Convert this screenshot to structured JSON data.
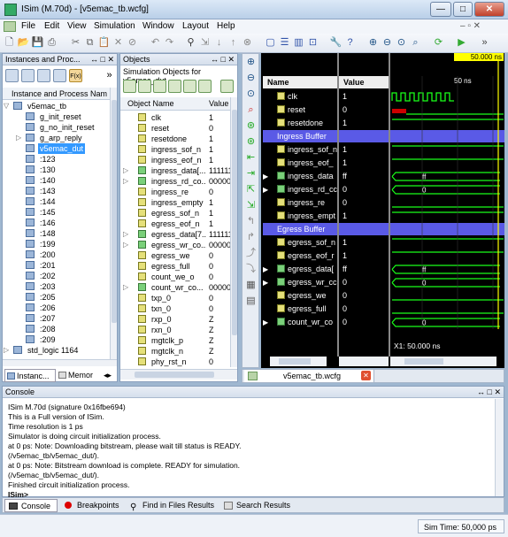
{
  "window": {
    "title": "ISim (M.70d) - [v5emac_tb.wcfg]",
    "buttons": [
      "—",
      "□",
      "✕"
    ]
  },
  "menu": [
    "File",
    "Edit",
    "View",
    "Simulation",
    "Window",
    "Layout",
    "Help"
  ],
  "instances_panel": {
    "title": "Instances and Proc...",
    "column": "Instance and Process Nam",
    "tree": [
      {
        "label": "v5emac_tb",
        "level": 0,
        "expand": "▽"
      },
      {
        "label": "g_init_reset",
        "level": 1,
        "expand": ""
      },
      {
        "label": "g_no_init_reset",
        "level": 1,
        "expand": ""
      },
      {
        "label": "g_arp_reply",
        "level": 1,
        "expand": "▷"
      },
      {
        "label": "v5emac_dut",
        "level": 1,
        "expand": "",
        "selected": true
      },
      {
        "label": ":123",
        "level": 1
      },
      {
        "label": ":130",
        "level": 1
      },
      {
        "label": ":140",
        "level": 1
      },
      {
        "label": ":143",
        "level": 1
      },
      {
        "label": ":144",
        "level": 1
      },
      {
        "label": ":145",
        "level": 1
      },
      {
        "label": ":146",
        "level": 1
      },
      {
        "label": ":148",
        "level": 1
      },
      {
        "label": ":199",
        "level": 1
      },
      {
        "label": ":200",
        "level": 1
      },
      {
        "label": ":201",
        "level": 1
      },
      {
        "label": ":202",
        "level": 1
      },
      {
        "label": ":203",
        "level": 1
      },
      {
        "label": ":205",
        "level": 1
      },
      {
        "label": ":206",
        "level": 1
      },
      {
        "label": ":207",
        "level": 1
      },
      {
        "label": ":208",
        "level": 1
      },
      {
        "label": ":209",
        "level": 1
      },
      {
        "label": "std_logic 1164",
        "level": 0,
        "expand": "▷"
      }
    ],
    "tabs": [
      "Instanc...",
      "Memor"
    ]
  },
  "objects_panel": {
    "title": "Objects",
    "subtitle": "Simulation Objects for v5emac_dut",
    "col_name": "Object Name",
    "col_value": "Value",
    "rows": [
      {
        "name": "clk",
        "value": "1",
        "bus": false
      },
      {
        "name": "reset",
        "value": "0",
        "bus": false
      },
      {
        "name": "resetdone",
        "value": "1",
        "bus": false
      },
      {
        "name": "ingress_sof_n",
        "value": "1",
        "bus": false
      },
      {
        "name": "ingress_eof_n",
        "value": "1",
        "bus": false
      },
      {
        "name": "ingress_data[...",
        "value": "1111111",
        "bus": true
      },
      {
        "name": "ingress_rd_co...",
        "value": "0000000",
        "bus": true
      },
      {
        "name": "ingress_re",
        "value": "0",
        "bus": false
      },
      {
        "name": "ingress_empty",
        "value": "1",
        "bus": false
      },
      {
        "name": "egress_sof_n",
        "value": "1",
        "bus": false
      },
      {
        "name": "egress_eof_n",
        "value": "1",
        "bus": false
      },
      {
        "name": "egress_data[7...",
        "value": "1111111",
        "bus": true
      },
      {
        "name": "egress_wr_co...",
        "value": "0000000",
        "bus": true
      },
      {
        "name": "egress_we",
        "value": "0",
        "bus": false
      },
      {
        "name": "egress_full",
        "value": "0",
        "bus": false
      },
      {
        "name": "count_we_o",
        "value": "0",
        "bus": false
      },
      {
        "name": "count_wr_co...",
        "value": "00000",
        "bus": true
      },
      {
        "name": "txp_0",
        "value": "0",
        "bus": false
      },
      {
        "name": "txn_0",
        "value": "0",
        "bus": false
      },
      {
        "name": "rxp_0",
        "value": "Z",
        "bus": false
      },
      {
        "name": "rxn_0",
        "value": "Z",
        "bus": false
      },
      {
        "name": "mgtclk_p",
        "value": "Z",
        "bus": false
      },
      {
        "name": "mgtclk_n",
        "value": "Z",
        "bus": false
      },
      {
        "name": "phy_rst_n",
        "value": "0",
        "bus": false
      }
    ]
  },
  "wave": {
    "col_name": "Name",
    "col_value": "Value",
    "cursor_label": "50.000 ns",
    "tick_label": "50 ns",
    "rows": [
      {
        "name": "clk",
        "value": "1",
        "kind": "clock"
      },
      {
        "name": "reset",
        "value": "0",
        "kind": "reset"
      },
      {
        "name": "resetdone",
        "value": "1",
        "kind": "high"
      },
      {
        "name": "Ingress Buffer",
        "value": "",
        "kind": "group"
      },
      {
        "name": "ingress_sof_n",
        "value": "1",
        "kind": "high"
      },
      {
        "name": "ingress_eof_n",
        "value": "1",
        "kind": "high"
      },
      {
        "name": "ingress_data[7:0]",
        "value": "ff",
        "kind": "bus",
        "busval": "ff"
      },
      {
        "name": "ingress_rd_count",
        "value": "0",
        "kind": "bus",
        "busval": "0"
      },
      {
        "name": "ingress_re",
        "value": "0",
        "kind": "low"
      },
      {
        "name": "ingress_empty",
        "value": "1",
        "kind": "high"
      },
      {
        "name": "Egress Buffer",
        "value": "",
        "kind": "group"
      },
      {
        "name": "egress_sof_n",
        "value": "1",
        "kind": "high"
      },
      {
        "name": "egress_eof_n",
        "value": "1",
        "kind": "high"
      },
      {
        "name": "egress_data[7:0]",
        "value": "ff",
        "kind": "bus",
        "busval": "ff"
      },
      {
        "name": "egress_wr_count",
        "value": "0",
        "kind": "bus",
        "busval": "0"
      },
      {
        "name": "egress_we",
        "value": "0",
        "kind": "low"
      },
      {
        "name": "egress_full",
        "value": "0",
        "kind": "low"
      },
      {
        "name": "count_wr_count",
        "value": "0",
        "kind": "bus",
        "busval": "0"
      }
    ],
    "display_names": [
      "clk",
      "reset",
      "resetdone",
      "Ingress Buffer",
      "ingress_sof_n",
      "ingress_eof_",
      "ingress_data",
      "ingress_rd_cc",
      "ingress_re",
      "ingress_empt",
      "Egress Buffer",
      "egress_sof_n",
      "egress_eof_r",
      "egress_data[",
      "egress_wr_cc",
      "egress_we",
      "egress_full",
      "count_wr_co"
    ],
    "x1_label": "X1: 50.000 ns",
    "tab_label": "v5emac_tb.wcfg"
  },
  "console": {
    "title": "Console",
    "lines": [
      "ISim M.70d (signature 0x16fbe694)",
      "This is a Full version of ISim.",
      "Time resolution is 1 ps",
      "Simulator is doing circuit initialization process.",
      "at 0 ps: Note: Downloading bitstream, please wait till status is READY.",
      "  (/v5emac_tb/v5emac_dut/).",
      "at 0 ps: Note: Bitstream download is complete. READY for simulation.",
      "  (/v5emac_tb/v5emac_dut/).",
      "Finished circuit initialization process."
    ],
    "prompt": "ISim>"
  },
  "bottom_tabs": [
    "Console",
    "Breakpoints",
    "Find in Files Results",
    "Search Results"
  ],
  "status": {
    "sim_time": "Sim Time: 50,000 ps"
  },
  "colors": {
    "group": "#5a5ae6",
    "wave_green": "#1aff1a",
    "cursor": "#ffff00",
    "reset_red": "#cc0000"
  }
}
